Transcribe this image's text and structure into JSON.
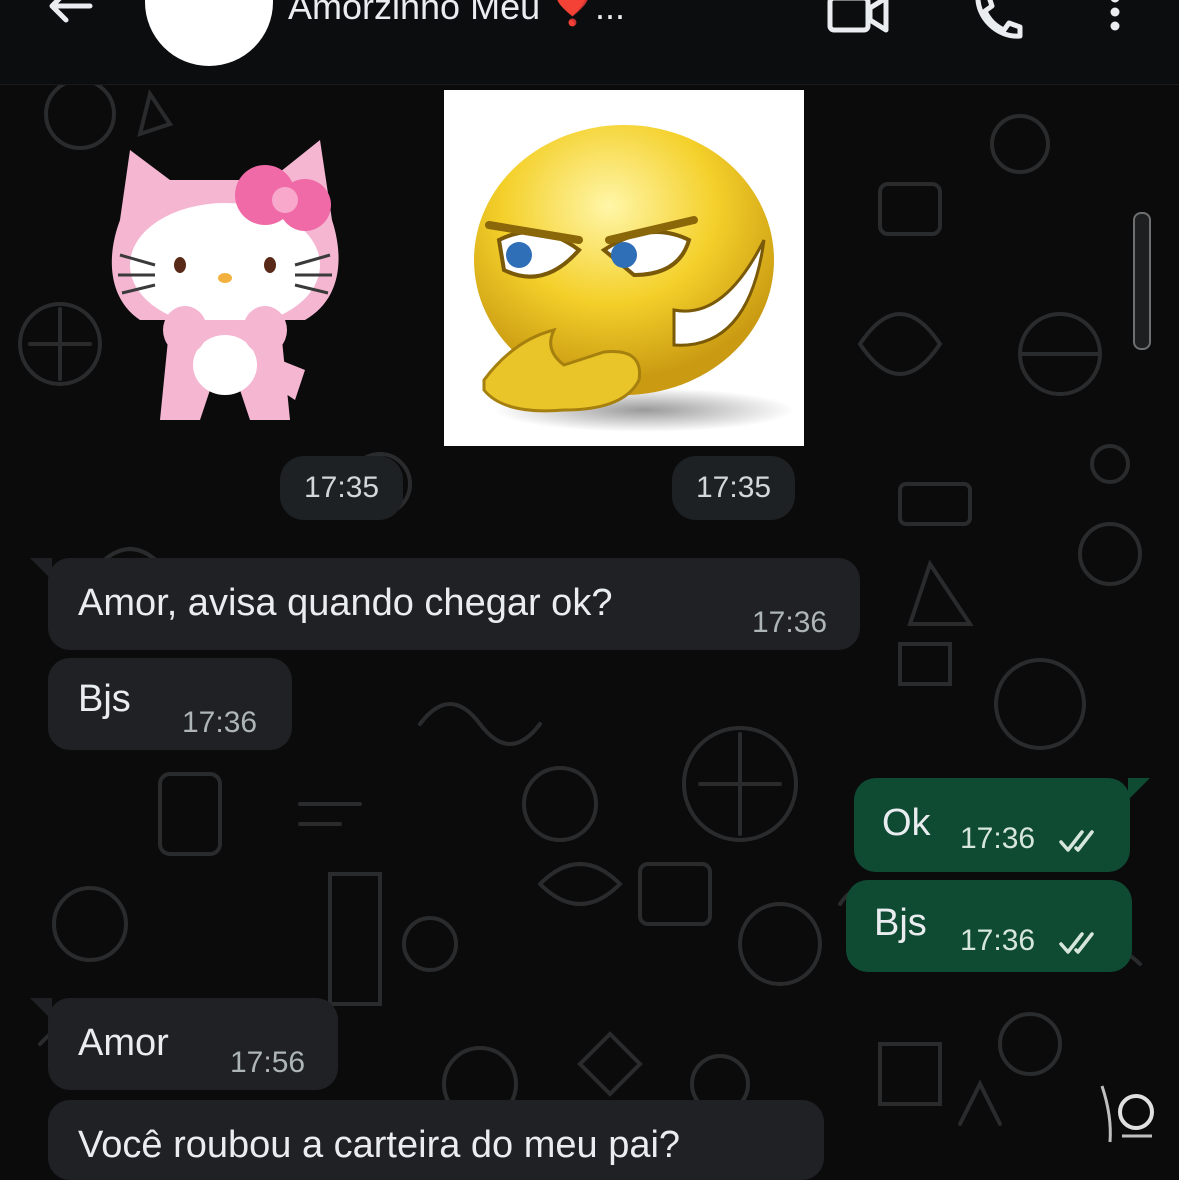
{
  "header": {
    "contact_name": "Amorzinho Meu",
    "contact_emoji": "❣️",
    "ellipsis": "...",
    "icons": [
      "back-arrow-icon",
      "video-call-icon",
      "phone-icon",
      "more-vertical-icon"
    ]
  },
  "stickers": [
    {
      "name": "hello-kitty-sticker",
      "time": "17:35"
    },
    {
      "name": "smirking-smiley-sticker",
      "time": "17:35"
    }
  ],
  "messages": [
    {
      "direction": "incoming",
      "text": "Amor, avisa quando chegar ok?",
      "time": "17:36"
    },
    {
      "direction": "incoming",
      "text": "Bjs",
      "time": "17:36"
    },
    {
      "direction": "outgoing",
      "text": "Ok",
      "time": "17:36",
      "status": "read"
    },
    {
      "direction": "outgoing",
      "text": "Bjs",
      "time": "17:36",
      "status": "read"
    },
    {
      "direction": "incoming",
      "text": "Amor",
      "time": "17:56"
    },
    {
      "direction": "incoming",
      "text": "Você roubou a carteira do meu pai?",
      "time": ""
    }
  ],
  "colors": {
    "background": "#0b0b0c",
    "incoming_bubble": "#1f2124",
    "outgoing_bubble": "#0f4a33",
    "header": "#0c0d0e"
  }
}
